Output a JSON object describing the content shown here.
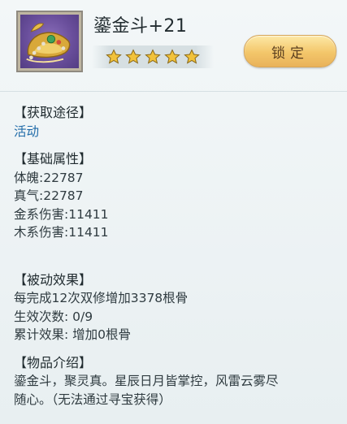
{
  "item": {
    "name": "鎏金斗+21",
    "star_count": 5,
    "lock_label": "锁定"
  },
  "sections": {
    "acquire": {
      "title": "【获取途径】",
      "link": "活动"
    },
    "base": {
      "title": "【基础属性】",
      "lines": [
        "体魄:22787",
        "真气:22787",
        "金系伤害:11411",
        "木系伤害:11411"
      ]
    },
    "passive": {
      "title": "【被动效果】",
      "lines": [
        "每完成12次双修增加3378根骨",
        "生效次数: 0/9",
        "累计效果: 增加0根骨"
      ]
    },
    "intro": {
      "title": "【物品介绍】",
      "lines": [
        "鎏金斗，聚灵真。星辰日月皆掌控，风雷云雾尽",
        "随心。（无法通过寻宝获得）"
      ]
    }
  },
  "colors": {
    "link": "#1f6aa8",
    "star": "#f2c23a",
    "button": "#f3c66a"
  }
}
